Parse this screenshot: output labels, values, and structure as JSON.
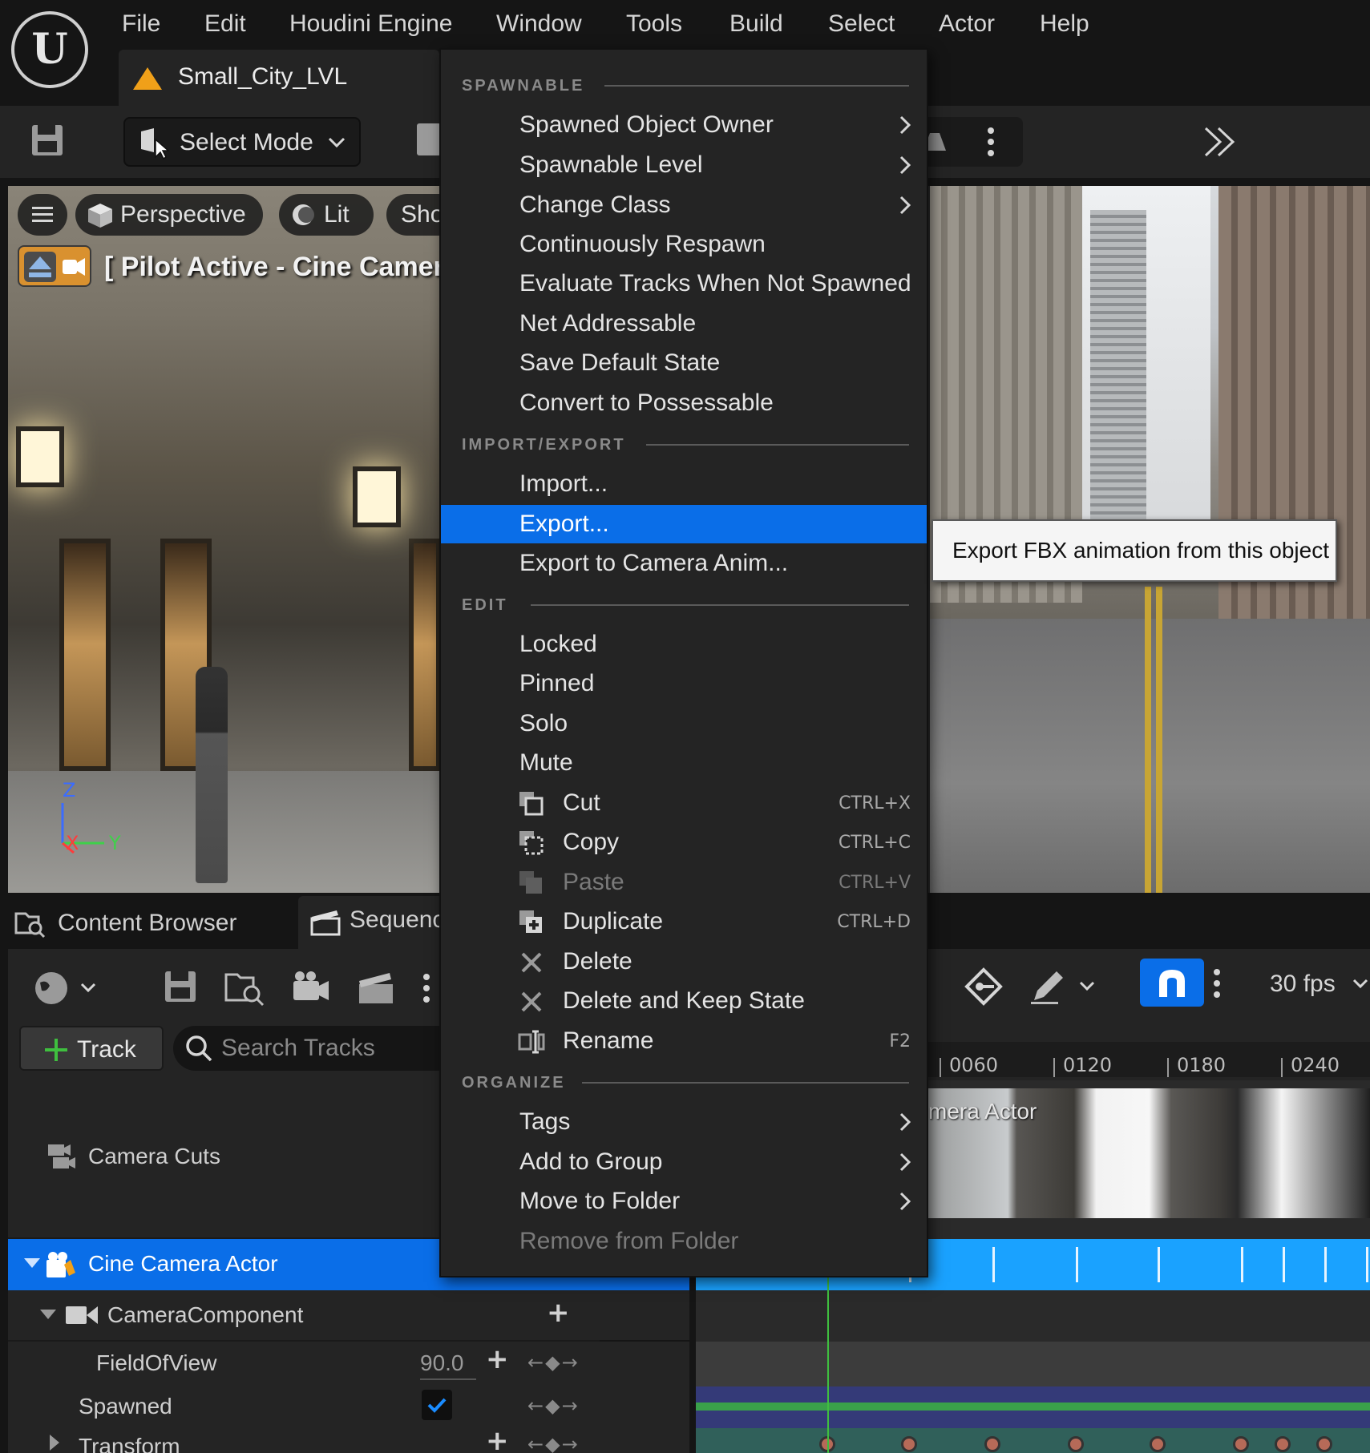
{
  "menubar": {
    "items": [
      "File",
      "Edit",
      "Houdini Engine",
      "Window",
      "Tools",
      "Build",
      "Select",
      "Actor",
      "Help"
    ],
    "level_tab": "Small_City_LVL"
  },
  "toolbar": {
    "select_mode": "Select Mode"
  },
  "viewport": {
    "perspective": "Perspective",
    "lit": "Lit",
    "show": "Sho",
    "pilot": "[ Pilot Active - Cine Camera Ac",
    "axis": {
      "z": "Z",
      "x": "X",
      "y": "Y"
    }
  },
  "bottom_tabs": {
    "content_browser": "Content Browser",
    "sequencer": "Sequenc"
  },
  "sequencer": {
    "add_track": "Track",
    "search_placeholder": "Search Tracks",
    "fps": "30 fps",
    "ruler": [
      "0060",
      "0120",
      "0180",
      "0240"
    ],
    "shot_label": "mera Actor",
    "tracks": {
      "camera_cuts": "Camera Cuts",
      "cine_camera_actor": "Cine Camera Actor",
      "camera_component": "CameraComponent",
      "field_of_view": "FieldOfView",
      "field_of_view_value": "90.0",
      "spawned": "Spawned",
      "spawned_checked": true,
      "transform": "Transform"
    }
  },
  "context_menu": {
    "sections": {
      "spawnable": "SPAWNABLE",
      "import_export": "IMPORT/EXPORT",
      "edit": "EDIT",
      "organize": "ORGANIZE"
    },
    "spawnable_items": [
      "Spawned Object Owner",
      "Spawnable Level",
      "Change Class",
      "Continuously Respawn",
      "Evaluate Tracks When Not Spawned",
      "Net Addressable",
      "Save Default State",
      "Convert to Possessable"
    ],
    "import_export_items": [
      "Import...",
      "Export...",
      "Export to Camera Anim..."
    ],
    "edit_toggles": [
      "Locked",
      "Pinned",
      "Solo",
      "Mute"
    ],
    "edit_actions": [
      {
        "label": "Cut",
        "shortcut": "CTRL+X",
        "icon": "cut-icon"
      },
      {
        "label": "Copy",
        "shortcut": "CTRL+C",
        "icon": "copy-icon"
      },
      {
        "label": "Paste",
        "shortcut": "CTRL+V",
        "icon": "paste-icon",
        "disabled": true
      },
      {
        "label": "Duplicate",
        "shortcut": "CTRL+D",
        "icon": "duplicate-icon"
      },
      {
        "label": "Delete",
        "shortcut": "",
        "icon": "delete-icon"
      },
      {
        "label": "Delete and Keep State",
        "shortcut": "",
        "icon": "delete-icon"
      },
      {
        "label": "Rename",
        "shortcut": "F2",
        "icon": "rename-icon"
      }
    ],
    "organize_items": [
      "Tags",
      "Add to Group",
      "Move to Folder",
      "Remove from Folder"
    ],
    "highlighted": "Export..."
  },
  "tooltip": "Export FBX animation from this object",
  "colors": {
    "accent": "#0a6ee8",
    "track_highlight": "#1aa2ff",
    "menu_bg": "#242424",
    "app_bg": "#151515"
  }
}
